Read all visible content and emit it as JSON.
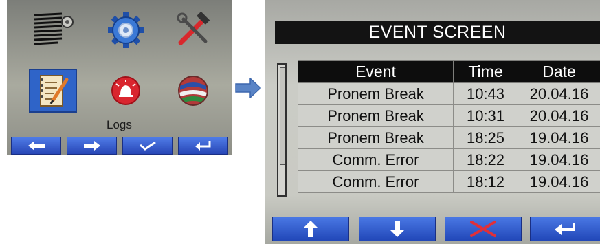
{
  "menu_screen": {
    "icons": [
      {
        "name": "blinds-motor-icon"
      },
      {
        "name": "settings-gear-icon"
      },
      {
        "name": "tools-icon"
      },
      {
        "name": "logs-notepad-icon",
        "selected": true
      },
      {
        "name": "alarm-icon"
      },
      {
        "name": "language-flags-icon"
      }
    ],
    "selected_label": "Logs",
    "nav_buttons": [
      "left-arrow-icon",
      "right-arrow-icon",
      "checkmark-icon",
      "enter-return-icon"
    ],
    "colors": {
      "selection": "#2f64c8",
      "button": "#2b50c0"
    }
  },
  "event_screen": {
    "title": "EVENT SCREEN",
    "columns": {
      "event": "Event",
      "time": "Time",
      "date": "Date"
    },
    "rows": [
      {
        "event": "Pronem Break",
        "time": "10:43",
        "date": "20.04.16"
      },
      {
        "event": "Pronem Break",
        "time": "10:31",
        "date": "20.04.16"
      },
      {
        "event": "Pronem Break",
        "time": "18:25",
        "date": "19.04.16"
      },
      {
        "event": "Comm. Error",
        "time": "18:22",
        "date": "19.04.16"
      },
      {
        "event": "Comm. Error",
        "time": "18:12",
        "date": "19.04.16"
      }
    ],
    "nav_buttons": [
      "up-arrow-icon",
      "down-arrow-icon",
      "red-x-icon",
      "enter-return-icon"
    ],
    "colors": {
      "title_bar": "#131313",
      "header": "#0d0d0d",
      "button": "#2853c6",
      "cancel_x": "#e0303a"
    }
  }
}
